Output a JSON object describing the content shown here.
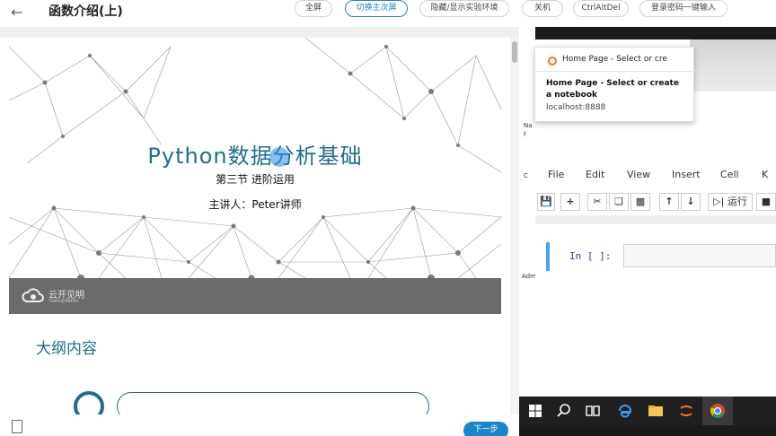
{
  "header": {
    "back_icon": "arrow-left-icon",
    "title": "函数介绍(上)",
    "buttons": [
      "全屏",
      "切换主次屏",
      "隐藏/显示实验环境",
      "关机",
      "CtrlAltDel",
      "登录密码一键输入"
    ],
    "active_button_index": 1,
    "accent_color": "#1a86c9"
  },
  "slide": {
    "title": "Python数据分析基础",
    "subtitle": "第三节 进阶运用",
    "lecturer": "主讲人：Peter讲师",
    "logo_text": "云开见明",
    "logo_subtext": "YUNKAIJIANMING",
    "accent_color": "#1f6e8c"
  },
  "outline": {
    "title": "大纲内容"
  },
  "footer": {
    "next_label": "下一步",
    "doc_icon": "document-icon"
  },
  "remote": {
    "sidebar_labels": [
      "Na",
      "f",
      "C",
      "Adm"
    ],
    "tooltip": {
      "tab_text": "Home Page - Select or cre",
      "title": "Home Page - Select or create a notebook",
      "url": "localhost:8888"
    },
    "menu": [
      "File",
      "Edit",
      "View",
      "Insert",
      "Cell",
      "K"
    ],
    "toolbar": {
      "run_label": "运行",
      "icons": [
        "save-icon",
        "plus-icon",
        "cut-icon",
        "copy-icon",
        "paste-icon",
        "arrow-up-icon",
        "arrow-down-icon",
        "step-forward-icon",
        "stop-icon"
      ]
    },
    "cell_prompt": "In [ ]:",
    "taskbar_icons": [
      "windows-start-icon",
      "search-icon",
      "task-view-icon",
      "edge-icon",
      "file-explorer-icon",
      "jupyter-icon",
      "chrome-icon"
    ]
  }
}
